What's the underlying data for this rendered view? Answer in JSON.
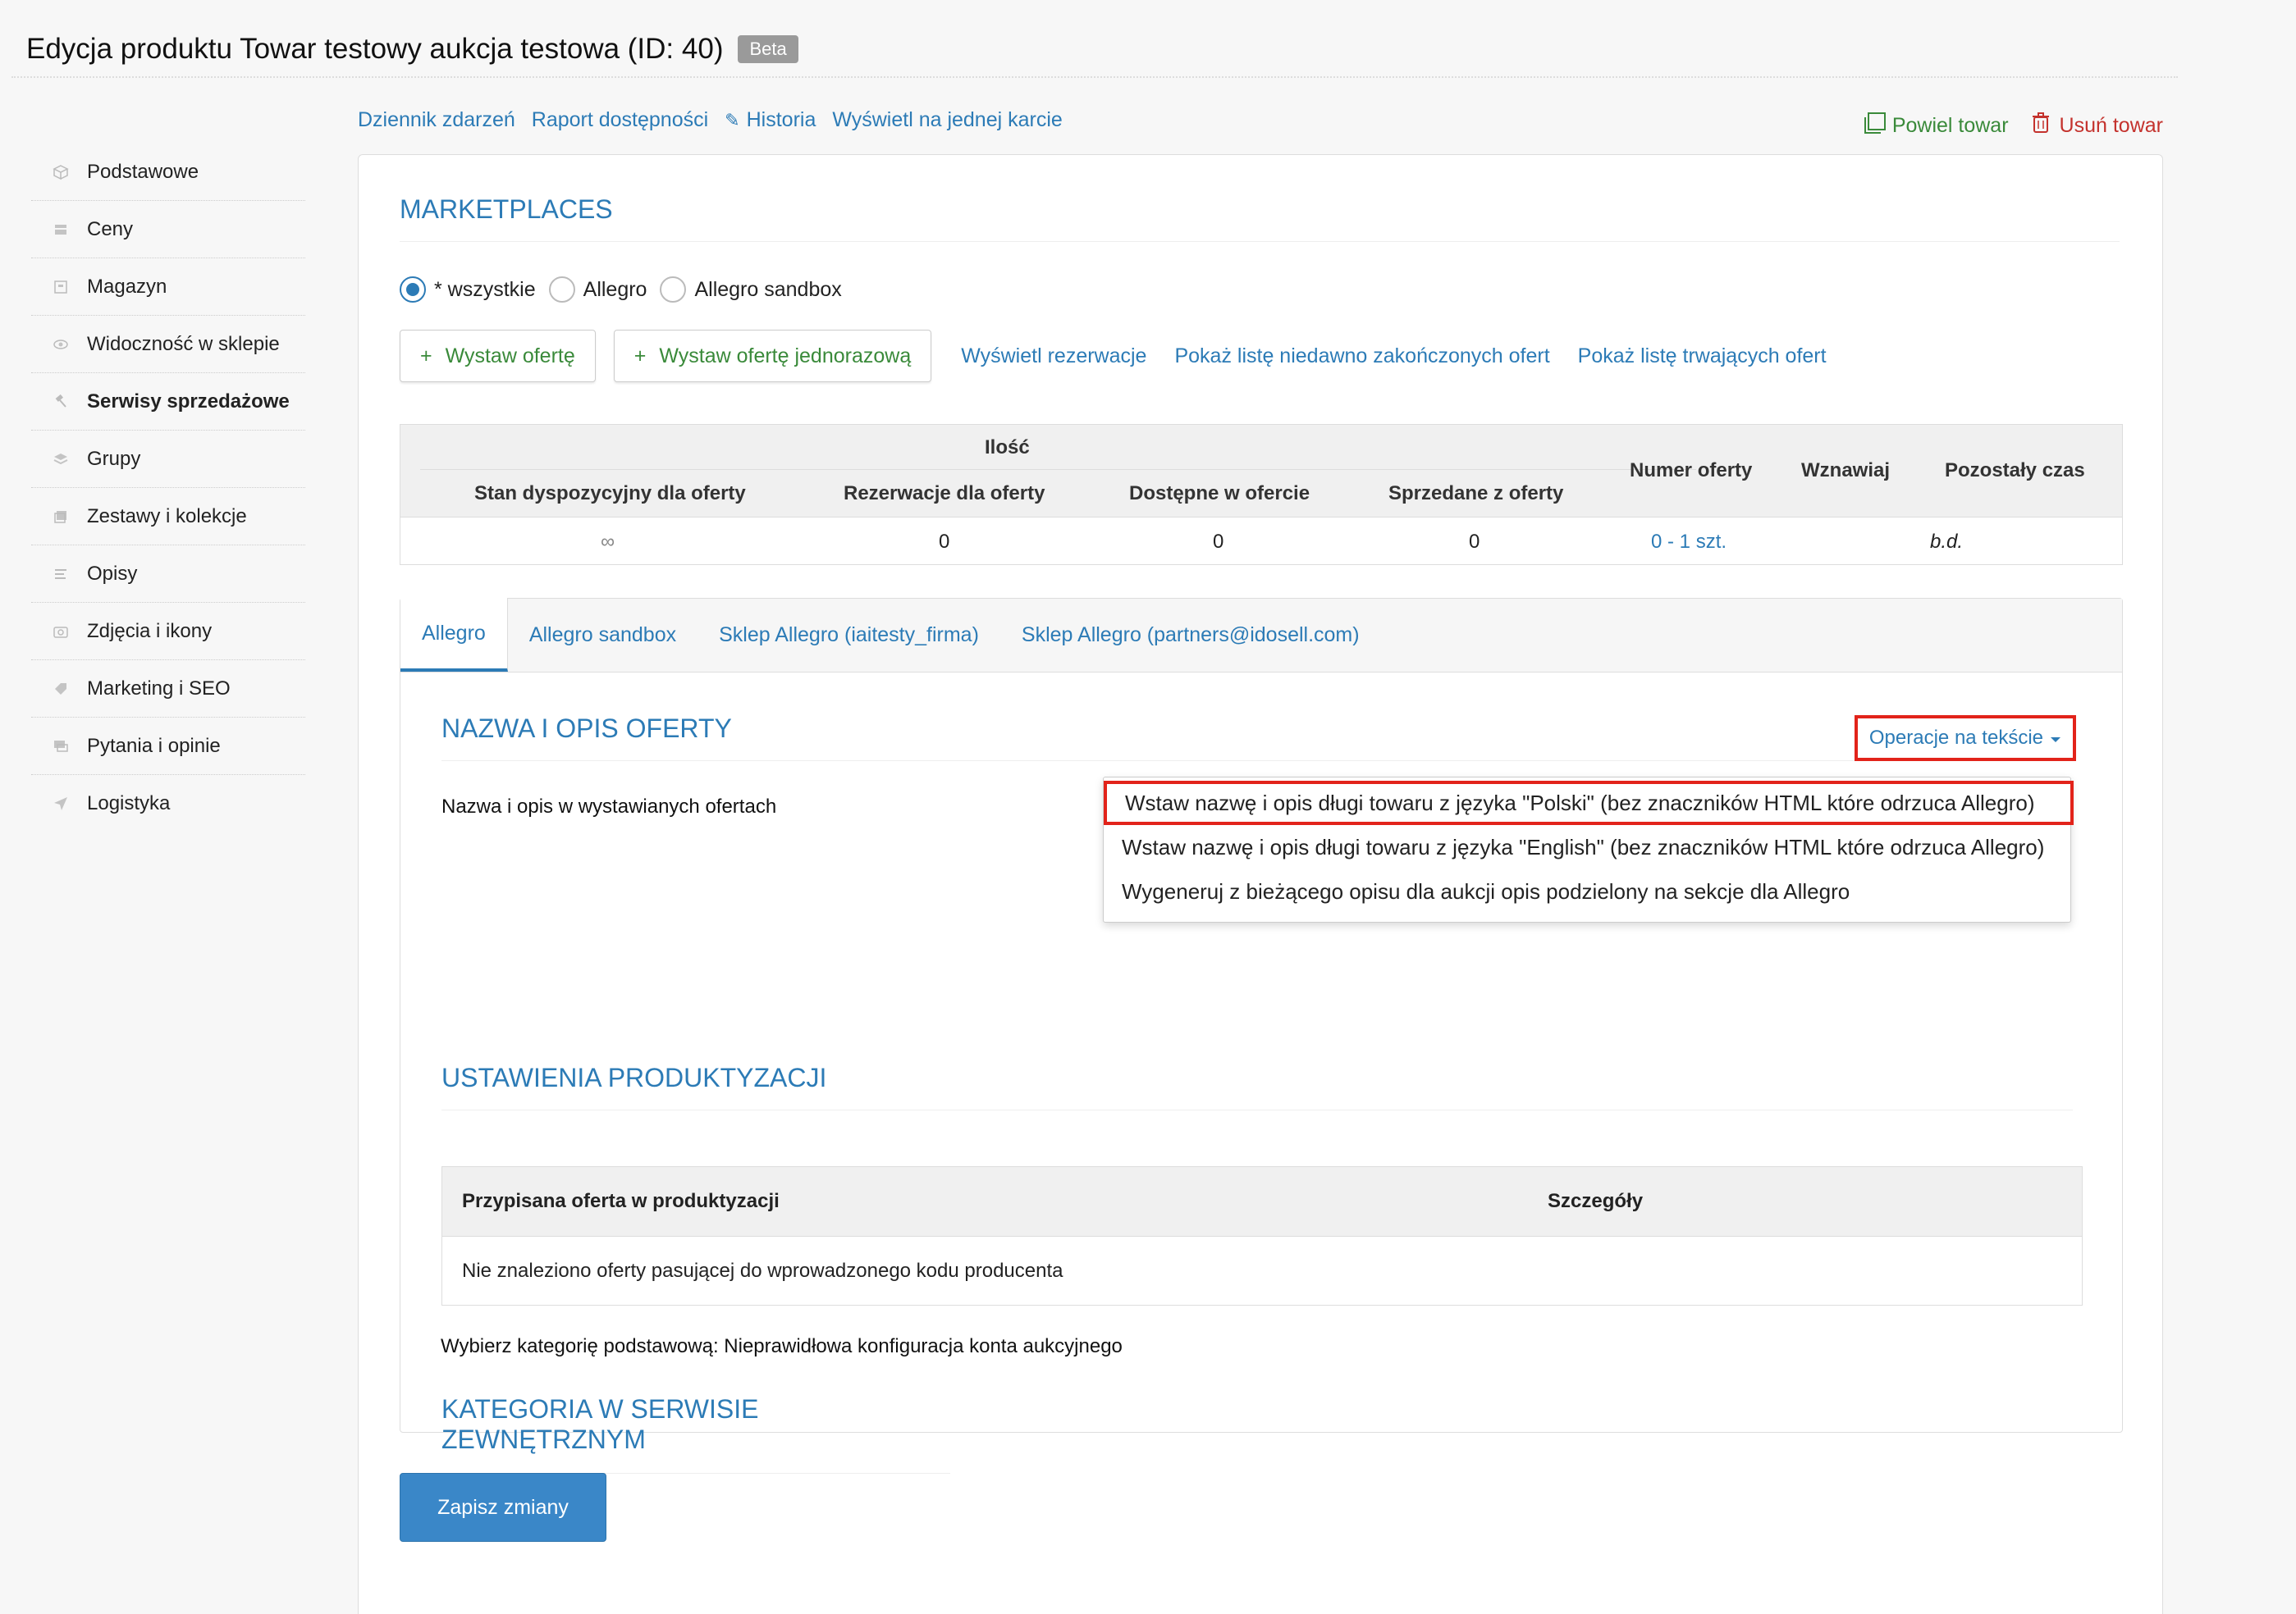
{
  "header": {
    "title": "Edycja produktu Towar testowy aukcja testowa (ID: 40)",
    "badge": "Beta"
  },
  "sidebar": {
    "items": [
      {
        "label": "Podstawowe",
        "icon": "box-icon"
      },
      {
        "label": "Ceny",
        "icon": "price-icon"
      },
      {
        "label": "Magazyn",
        "icon": "warehouse-icon"
      },
      {
        "label": "Widoczność w sklepie",
        "icon": "eye-icon"
      },
      {
        "label": "Serwisy sprzedażowe",
        "icon": "gavel-icon",
        "active": true
      },
      {
        "label": "Grupy",
        "icon": "layers-icon"
      },
      {
        "label": "Zestawy i kolekcje",
        "icon": "collection-icon"
      },
      {
        "label": "Opisy",
        "icon": "text-icon"
      },
      {
        "label": "Zdjęcia i ikony",
        "icon": "camera-icon"
      },
      {
        "label": "Marketing i SEO",
        "icon": "tag-icon"
      },
      {
        "label": "Pytania i opinie",
        "icon": "chat-icon"
      },
      {
        "label": "Logistyka",
        "icon": "plane-icon"
      }
    ]
  },
  "top_links": {
    "events": "Dziennik zdarzeń",
    "availability": "Raport dostępności",
    "history": "Historia",
    "single_card": "Wyświetl na jednej karcie"
  },
  "top_actions": {
    "duplicate": "Powiel towar",
    "delete": "Usuń towar"
  },
  "marketplaces": {
    "heading": "MARKETPLACES",
    "radio": {
      "all": "* wszystkie",
      "allegro": "Allegro",
      "sandbox": "Allegro sandbox"
    },
    "buttons": {
      "offer": "Wystaw ofertę",
      "offer_single": "Wystaw ofertę jednorazową"
    },
    "links": {
      "reservations": "Wyświetl rezerwacje",
      "recent_finished": "Pokaż listę niedawno zakończonych ofert",
      "ongoing": "Pokaż listę trwających ofert"
    }
  },
  "qty_table": {
    "group": "Ilość",
    "headers": {
      "stock": "Stan dyspozycyjny dla oferty",
      "reservations": "Rezerwacje dla oferty",
      "available": "Dostępne w ofercie",
      "sold": "Sprzedane z oferty",
      "offer_number": "Numer oferty",
      "renew": "Wznawiaj",
      "remaining": "Pozostały czas"
    },
    "row": {
      "stock": "∞",
      "reservations": "0",
      "available": "0",
      "sold": "0",
      "offer_number": "0 - 1 szt.",
      "renew": "",
      "remaining": "b.d."
    }
  },
  "tabs": [
    "Allegro",
    "Allegro sandbox",
    "Sklep Allegro (iaitesty_firma)",
    "Sklep Allegro (partners@idosell.com)"
  ],
  "name_section": {
    "heading": "NAZWA I OPIS OFERTY",
    "ops_button": "Operacje na tekście",
    "text": "Nazwa i opis w wystawianych ofertach",
    "dropdown": [
      "Wstaw nazwę i opis długi towaru z języka \"Polski\" (bez znaczników HTML które odrzuca Allegro)",
      "Wstaw nazwę i opis długi towaru z języka \"English\" (bez znaczników HTML które odrzuca Allegro)",
      "Wygeneruj z bieżącego opisu dla aukcji opis podzielony na sekcje dla Allegro"
    ]
  },
  "product_section": {
    "heading": "USTAWIENIA PRODUKTYZACJI",
    "headers": {
      "assigned": "Przypisana oferta w produktyzacji",
      "details": "Szczegóły"
    },
    "row": "Nie znaleziono oferty pasującej do wprowadzonego kodu producenta"
  },
  "category_section": {
    "heading": "KATEGORIA W SERWISIE ZEWNĘTRZNYM",
    "text": "Wybierz kategorię podstawową: Nieprawidłowa konfiguracja konta aukcyjnego"
  },
  "save_button": "Zapisz zmiany",
  "colors": {
    "link": "#2c7bb6",
    "green": "#3a8a3a",
    "red": "#c4322d",
    "highlight": "#e2231a"
  }
}
